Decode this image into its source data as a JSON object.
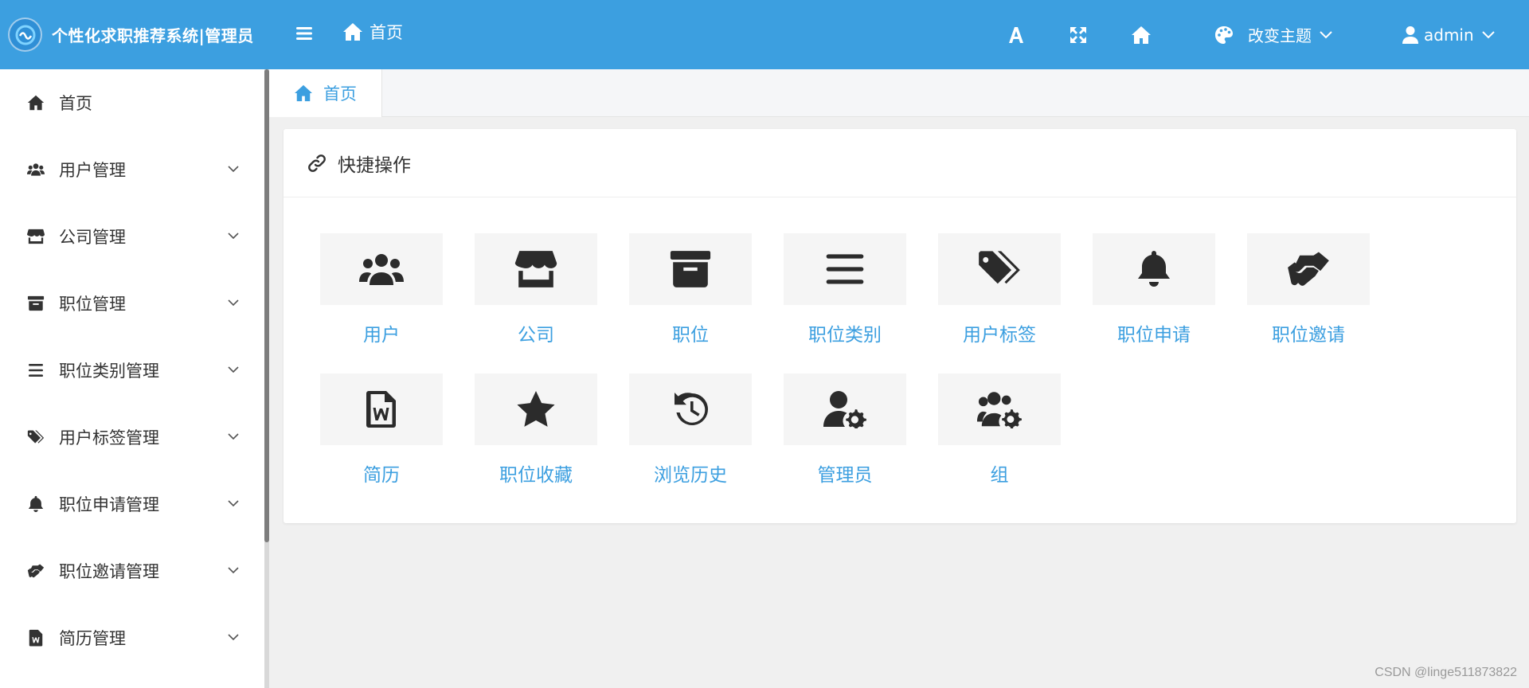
{
  "app": {
    "title": "个性化求职推荐系统|管理员"
  },
  "header": {
    "home_label": "首页",
    "theme_label": "改变主题",
    "user_label": "admin"
  },
  "sidebar": {
    "items": [
      {
        "label": "首页",
        "icon": "home-icon"
      },
      {
        "label": "用户管理",
        "icon": "users-icon"
      },
      {
        "label": "公司管理",
        "icon": "store-icon"
      },
      {
        "label": "职位管理",
        "icon": "archive-icon"
      },
      {
        "label": "职位类别管理",
        "icon": "list-icon"
      },
      {
        "label": "用户标签管理",
        "icon": "tags-icon"
      },
      {
        "label": "职位申请管理",
        "icon": "bell-icon"
      },
      {
        "label": "职位邀请管理",
        "icon": "handshake-icon"
      },
      {
        "label": "简历管理",
        "icon": "word-file-icon"
      }
    ]
  },
  "tabs": {
    "active_label": "首页"
  },
  "quick_actions": {
    "title": "快捷操作",
    "items": [
      {
        "label": "用户",
        "icon": "users-icon"
      },
      {
        "label": "公司",
        "icon": "store-icon"
      },
      {
        "label": "职位",
        "icon": "archive-icon"
      },
      {
        "label": "职位类别",
        "icon": "list-icon"
      },
      {
        "label": "用户标签",
        "icon": "tags-icon"
      },
      {
        "label": "职位申请",
        "icon": "bell-icon"
      },
      {
        "label": "职位邀请",
        "icon": "handshake-icon"
      },
      {
        "label": "简历",
        "icon": "word-file-icon"
      },
      {
        "label": "职位收藏",
        "icon": "star-icon"
      },
      {
        "label": "浏览历史",
        "icon": "history-icon"
      },
      {
        "label": "管理员",
        "icon": "user-gear-icon"
      },
      {
        "label": "组",
        "icon": "users-gear-icon"
      }
    ]
  },
  "watermark": "CSDN @linge511873822",
  "colors": {
    "primary": "#3c9fe0",
    "sidebar_bg": "#ffffff",
    "content_bg": "#f0f0f0",
    "icon_dark": "#2b2b2b"
  }
}
